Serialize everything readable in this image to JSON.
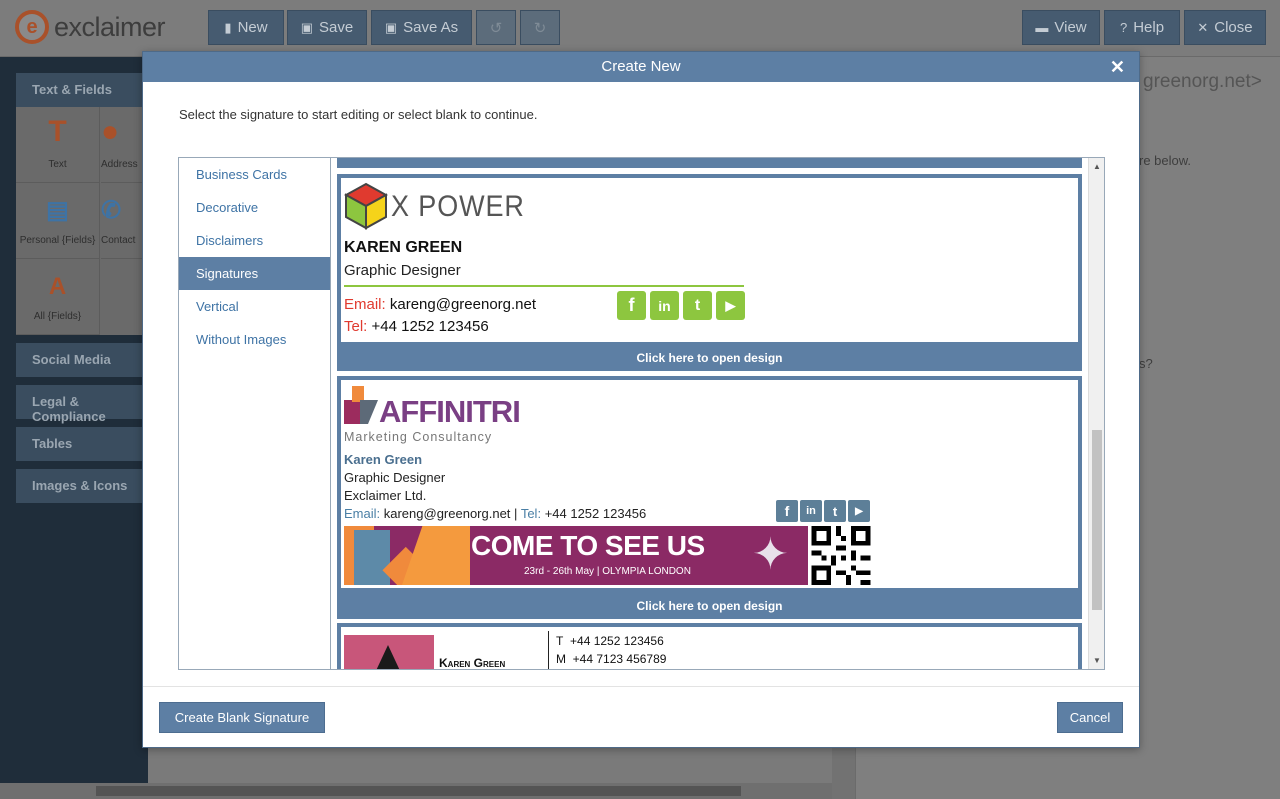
{
  "app": {
    "logo_text": "exclaimer",
    "toolbar": {
      "new": "New",
      "save": "Save",
      "save_as": "Save As",
      "view": "View",
      "help": "Help",
      "close": "Close"
    }
  },
  "left_panel": {
    "sections": [
      "Text & Fields",
      "Social Media",
      "Legal & Compliance",
      "Tables",
      "Images & Icons"
    ],
    "tiles": [
      "Text",
      "Address",
      "Personal {Fields}",
      "Contact",
      "All {Fields}"
    ]
  },
  "right_panel": {
    "email_fragment": "greenorg.net>",
    "hint_fragment": "re below.",
    "question_fragment": "s?"
  },
  "modal": {
    "title": "Create New",
    "close_glyph": "✕",
    "instruction": "Select the signature to start editing or select blank to continue.",
    "categories": [
      "Business Cards",
      "Decorative",
      "Disclaimers",
      "Signatures",
      "Vertical",
      "Without Images"
    ],
    "active_category": "Signatures",
    "open_design_label": "Click here to open design",
    "designs": {
      "xpower": {
        "brand": "X POWER",
        "name": "KAREN GREEN",
        "title": "Graphic Designer",
        "email_label": "Email:",
        "email": "kareng@greenorg.net",
        "tel_label": "Tel:",
        "tel": "+44 1252 123456"
      },
      "affinitri": {
        "brand": "AFFINITRI",
        "tagline": "Marketing Consultancy",
        "name": "Karen Green",
        "title": "Graphic Designer",
        "company": "Exclaimer Ltd.",
        "email_label": "Email:",
        "email": "kareng@greenorg.net",
        "separator": "|",
        "tel_label": "Tel:",
        "tel": "+44 1252 123456",
        "banner_headline": "COME TO SEE US",
        "banner_sub": "23rd - 26th May | OLYMPIA LONDON"
      },
      "third": {
        "name": "Karen Green",
        "t_label": "T",
        "t_value": "+44 1252 123456",
        "m_label": "M",
        "m_value": "+44 7123 456789"
      }
    },
    "buttons": {
      "create_blank": "Create Blank Signature",
      "cancel": "Cancel"
    }
  },
  "colors": {
    "modal_header": "#5d7fa4",
    "link": "#3e73a5",
    "xpower_social": "#8dc63f",
    "affinitri_social": "#5d7f98",
    "banner": "#8b2a65"
  }
}
